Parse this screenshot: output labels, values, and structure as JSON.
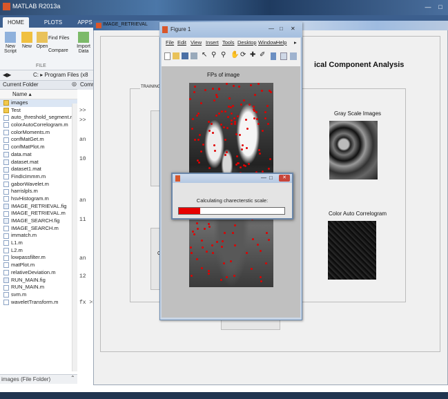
{
  "matlab": {
    "title": "MATLAB R2013a",
    "tabs": [
      "HOME",
      "PLOTS",
      "APPS"
    ],
    "ribbon": {
      "new_script": "New\nScript",
      "new": "New",
      "open": "Open",
      "find_files": "Find Files",
      "compare": "Compare",
      "import_data": "Import\nData",
      "section": "FILE"
    },
    "path": "C: ▸ Program Files (x8",
    "current_folder_label": "Current Folder",
    "command_label": "Comm",
    "name_header": "Name ▴",
    "files": [
      "images",
      "Test",
      "auto_threshold_segment.m",
      "colorAutoCorrelogram.m",
      "colorMoments.m",
      "confMatGet.m",
      "confMatPlot.m",
      "data.mat",
      "dataset.mat",
      "dataset1.mat",
      "FindIcImmm.m",
      "gaborWavelet.m",
      "harrislpls.m",
      "hsvHistogram.m",
      "IMAGE_RETRIEVAL.fig",
      "IMAGE_RETRIEVAL.m",
      "IMAGE_SEARCH.fig",
      "IMAGE_SEARCH.m",
      "immatch.m",
      "L1.m",
      "L2.m",
      "lowpassfilter.m",
      "matPlot.m",
      "relativeDeviation.m",
      "RUN_MAIN.fig",
      "RUN_MAIN.m",
      "svm.m",
      "waveletTransform.m"
    ],
    "file_types": [
      "folder",
      "folder",
      "m",
      "m",
      "m",
      "m",
      "m",
      "mat",
      "mat",
      "mat",
      "m",
      "m",
      "m",
      "m",
      "fig",
      "m",
      "fig",
      "m",
      "m",
      "m",
      "m",
      "m",
      "m",
      "m",
      "fig",
      "m",
      "m",
      "m"
    ],
    "status": "images (File Folder)",
    "cmd_lines": [
      ">>",
      ">>",
      "an",
      "10",
      "an",
      "11",
      "an",
      "12",
      "fx >>"
    ]
  },
  "image_retrieval": {
    "title": "IMAGE_RETRIEVAL",
    "heading": "ical Component Analysis",
    "training_label": "TRAINING IM",
    "gray_label": "Gray Scale Images",
    "color_label": "Color Auto Correlogram",
    "ghost_cr": "Cr"
  },
  "figure1": {
    "title": "Figure 1",
    "menu": [
      "File",
      "Edit",
      "View",
      "Insert",
      "Tools",
      "Desktop",
      "Window",
      "Help"
    ],
    "axes_title": "FPs of image"
  },
  "progress": {
    "message": "Calculating charecterstic scale:",
    "fraction": 0.2
  },
  "colors": {
    "accent": "#3c5f8e",
    "progress": "#e60000",
    "feature_points": "#e00000"
  }
}
